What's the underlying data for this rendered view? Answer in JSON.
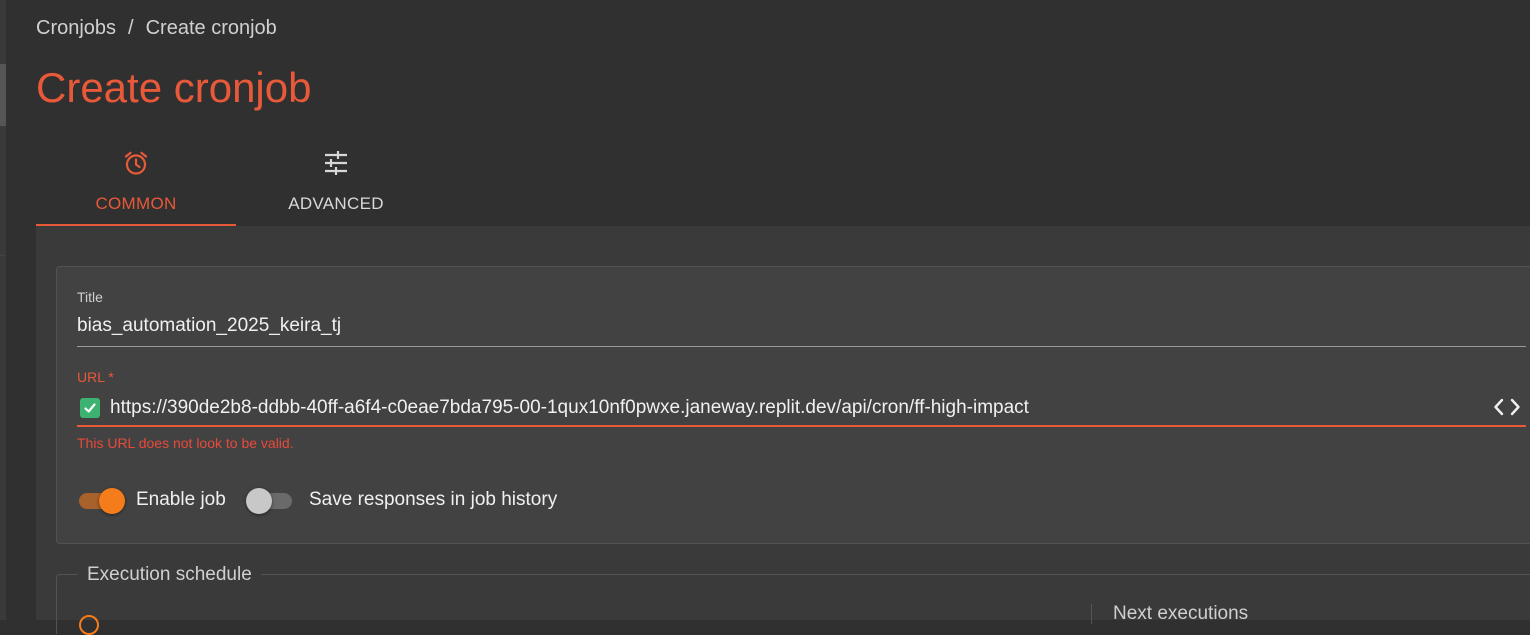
{
  "breadcrumb": {
    "parent": "Cronjobs",
    "separator": "/",
    "current": "Create cronjob"
  },
  "page_title": "Create cronjob",
  "tabs": [
    {
      "label": "COMMON",
      "icon": "alarm-clock-icon",
      "active": true
    },
    {
      "label": "ADVANCED",
      "icon": "sliders-icon",
      "active": false
    }
  ],
  "form": {
    "title_label": "Title",
    "title_value": "bias_automation_2025_keira_tj",
    "url_label": "URL *",
    "url_value": "https://390de2b8-ddbb-40ff-a6f4-c0eae7bda795-00-1qux10nf0pwxe.janeway.replit.dev/api/cron/ff-high-impact",
    "url_error": "This URL does not look to be valid.",
    "url_icon": "checkbox-check-icon",
    "url_end_icon": "code-icon",
    "enable_job_label": "Enable job",
    "enable_job": true,
    "save_responses_label": "Save responses in job history",
    "save_responses": false
  },
  "schedule": {
    "legend": "Execution schedule",
    "next_executions": "Next executions"
  },
  "colors": {
    "accent": "#e8593a",
    "switch_on": "#f57c1a",
    "check_green": "#3cb371",
    "background": "#303030"
  }
}
